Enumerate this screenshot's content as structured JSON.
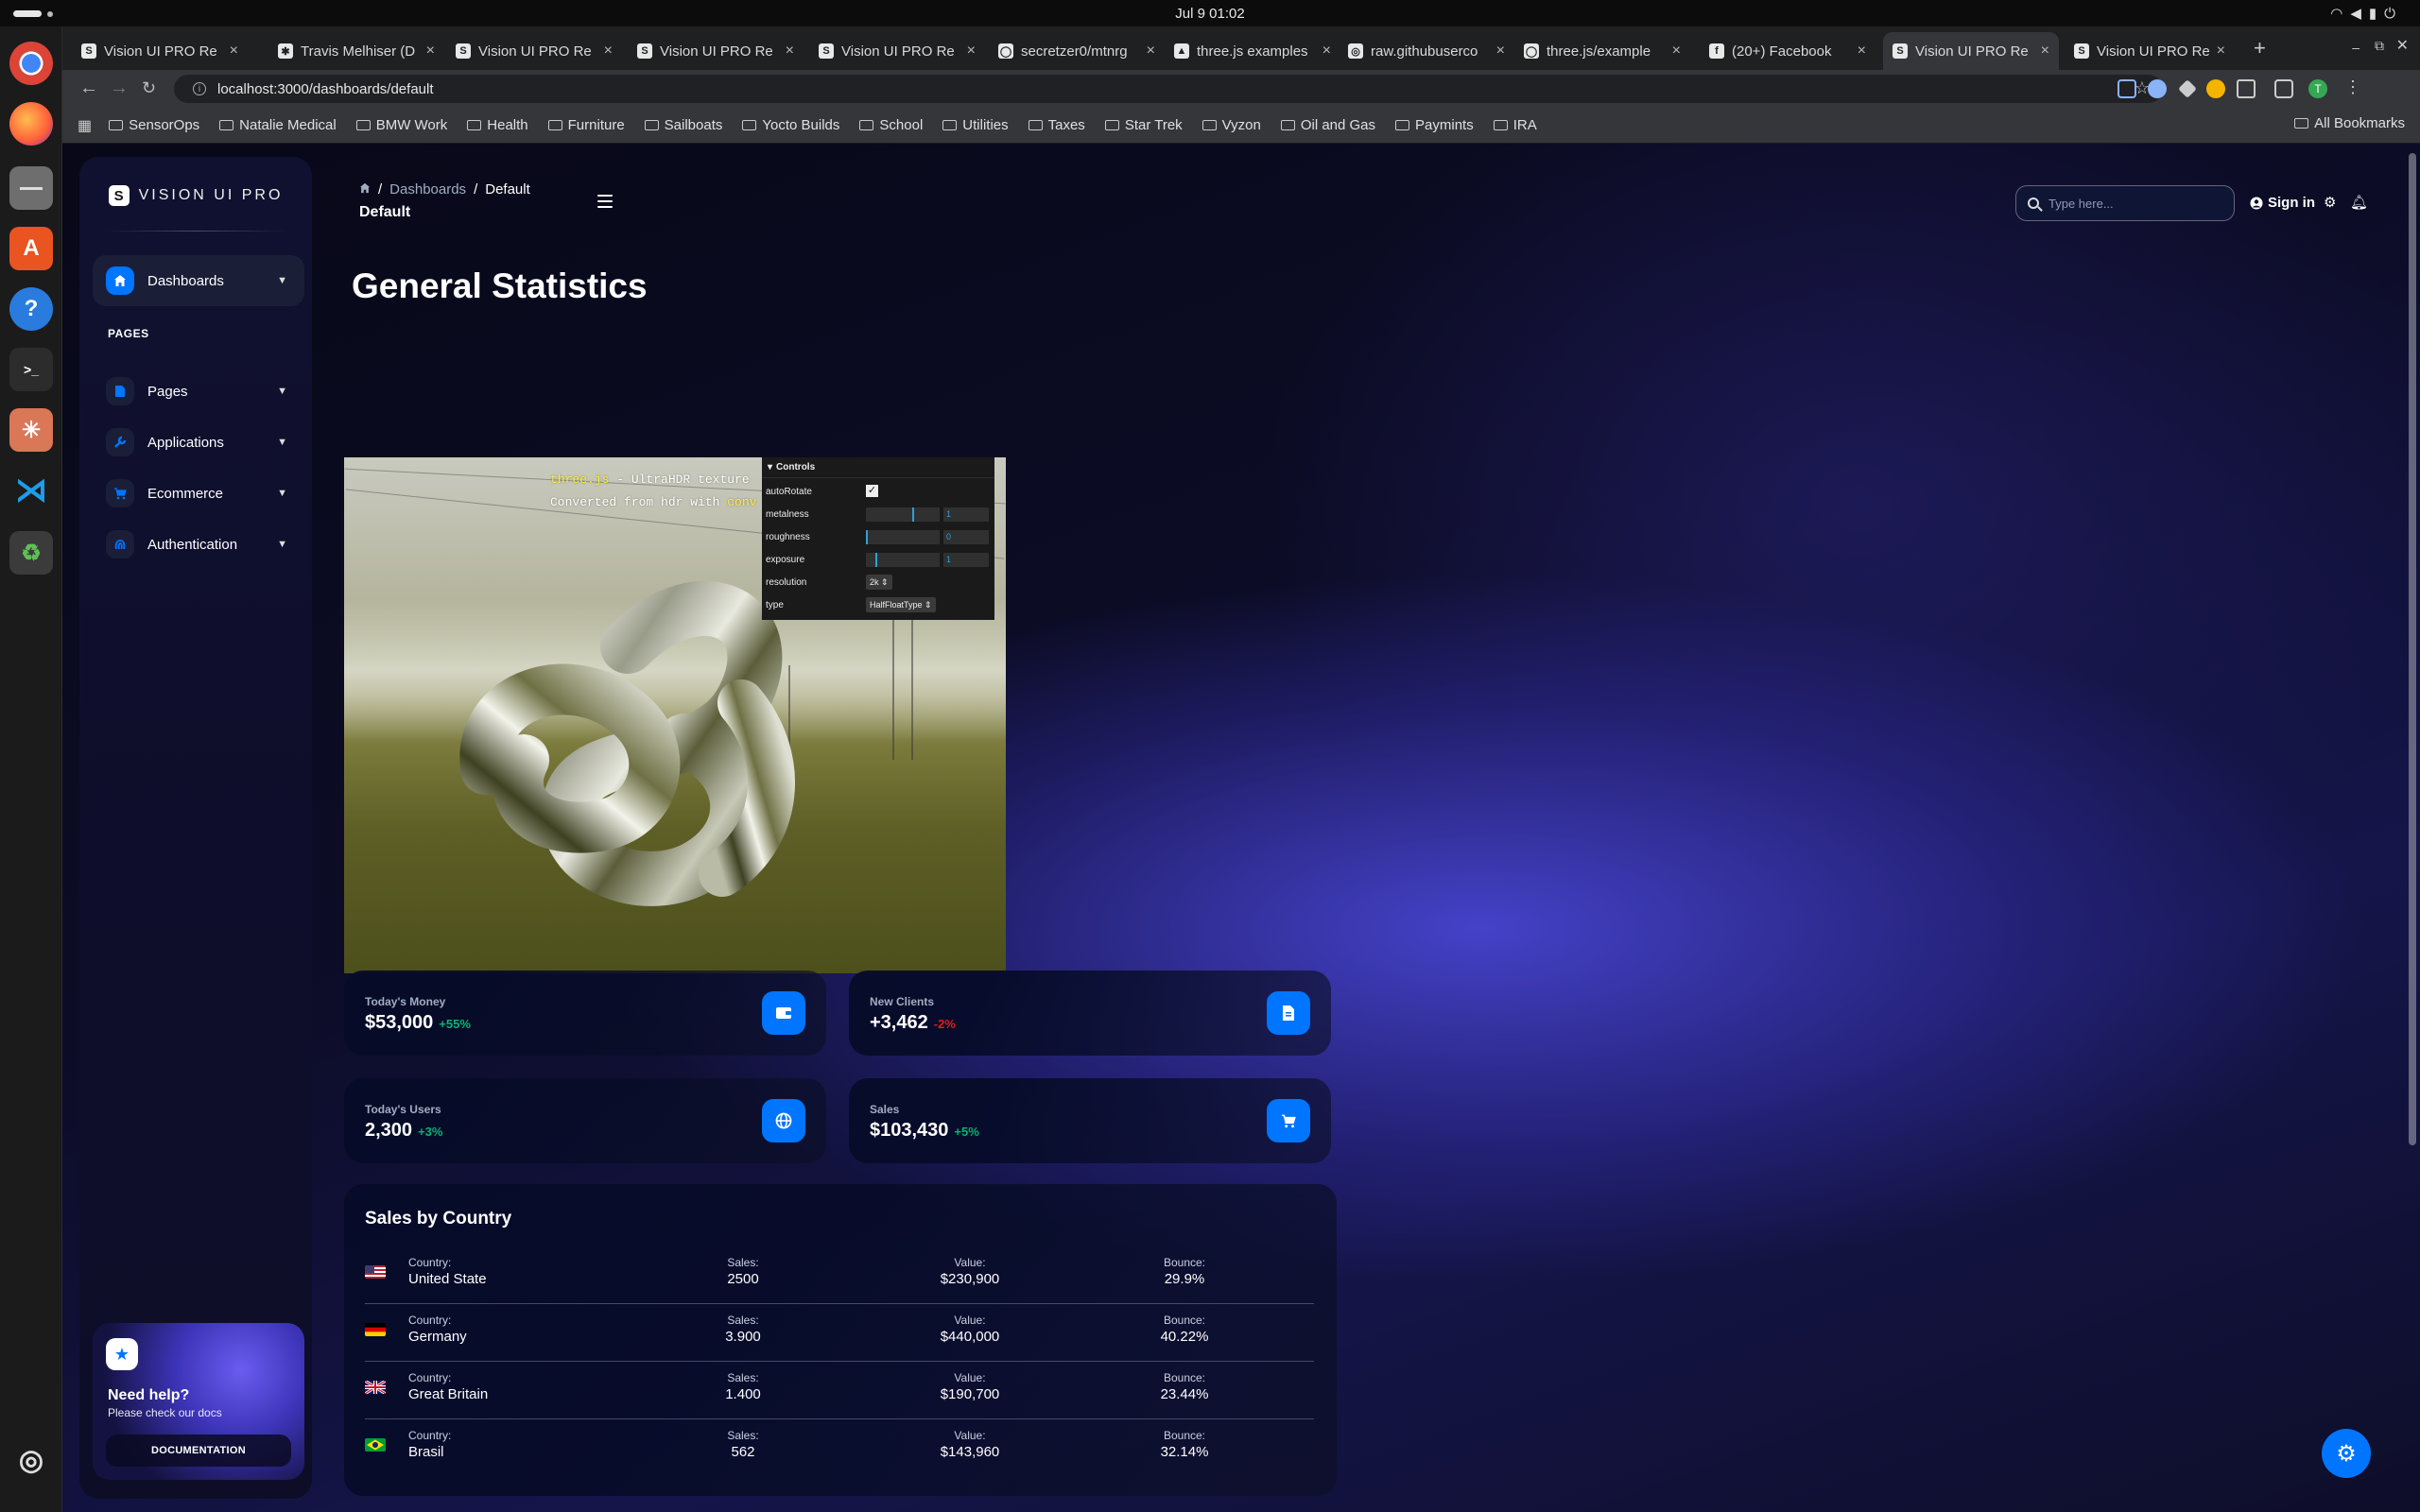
{
  "system": {
    "clock": "Jul 9  01:02"
  },
  "dock": {
    "apps": [
      "chrome",
      "firefox",
      "files",
      "software",
      "help",
      "terminal",
      "anthropic",
      "vscode",
      "trash",
      "ubuntu"
    ]
  },
  "browser": {
    "tabs": [
      {
        "title": "Vision UI PRO Re",
        "active": false
      },
      {
        "title": "Travis Melhiser (D",
        "active": false
      },
      {
        "title": "Vision UI PRO Re",
        "active": false
      },
      {
        "title": "Vision UI PRO Re",
        "active": false
      },
      {
        "title": "Vision UI PRO Re",
        "active": false
      },
      {
        "title": "secretzer0/mtnrg",
        "active": false
      },
      {
        "title": "three.js examples",
        "active": false
      },
      {
        "title": "raw.githubuserco",
        "active": false
      },
      {
        "title": "three.js/example",
        "active": false
      },
      {
        "title": "(20+) Facebook",
        "active": false
      },
      {
        "title": "Vision UI PRO Re",
        "active": true
      },
      {
        "title": "Vision UI PRO Re",
        "active": false
      }
    ],
    "new_tab": "+",
    "url": "localhost:3000/dashboards/default",
    "bookmarks": [
      "SensorOps",
      "Natalie Medical",
      "BMW Work",
      "Health",
      "Furniture",
      "Sailboats",
      "Yocto Builds",
      "School",
      "Utilities",
      "Taxes",
      "Star Trek",
      "Vyzon",
      "Oil and Gas",
      "Paymints",
      "IRA"
    ],
    "all_bookmarks": "All Bookmarks",
    "profile_initial": "T"
  },
  "sidebar": {
    "brand": "VISION UI PRO",
    "brand_logo": "S",
    "active_item": "Dashboards",
    "section": "PAGES",
    "items": [
      "Pages",
      "Applications",
      "Ecommerce",
      "Authentication"
    ],
    "help": {
      "title": "Need help?",
      "subtitle": "Please check our docs",
      "button": "DOCUMENTATION"
    }
  },
  "header": {
    "breadcrumb": [
      "Dashboards",
      "Default"
    ],
    "title": "Default",
    "search_placeholder": "Type here...",
    "signin": "Sign in"
  },
  "page_title": "General Statistics",
  "embed": {
    "caption_link1": "three.js",
    "caption_rest1": " - UltraHDR texture",
    "caption_line2": "Converted from hdr with ",
    "caption_link2": "conv",
    "gui": {
      "title": "Controls",
      "autoRotate_label": "autoRotate",
      "autoRotate": true,
      "metalness_label": "metalness",
      "metalness": "1",
      "metalness_fill": 0.65,
      "roughness_label": "roughness",
      "roughness": "0",
      "roughness_fill": 0.0,
      "exposure_label": "exposure",
      "exposure": "1",
      "exposure_fill": 0.16,
      "resolution_label": "resolution",
      "resolution": "2k",
      "type_label": "type",
      "type": "HalfFloatType"
    }
  },
  "stats": [
    {
      "label": "Today's Money",
      "value": "$53,000",
      "change": "+55%",
      "trend": "up",
      "icon": "wallet-icon"
    },
    {
      "label": "New Clients",
      "value": "+3,462",
      "change": "-2%",
      "trend": "down",
      "icon": "document-icon"
    },
    {
      "label": "Today's Users",
      "value": "2,300",
      "change": "+3%",
      "trend": "up",
      "icon": "globe-icon"
    },
    {
      "label": "Sales",
      "value": "$103,430",
      "change": "+5%",
      "trend": "up",
      "icon": "cart-icon"
    }
  ],
  "sales_by_country": {
    "title": "Sales by Country",
    "headers": {
      "country": "Country:",
      "sales": "Sales:",
      "value": "Value:",
      "bounce": "Bounce:"
    },
    "rows": [
      {
        "flag": "us",
        "country": "United State",
        "sales": "2500",
        "value": "$230,900",
        "bounce": "29.9%"
      },
      {
        "flag": "de",
        "country": "Germany",
        "sales": "3.900",
        "value": "$440,000",
        "bounce": "40.22%"
      },
      {
        "flag": "gb",
        "country": "Great Britain",
        "sales": "1.400",
        "value": "$190,700",
        "bounce": "23.44%"
      },
      {
        "flag": "br",
        "country": "Brasil",
        "sales": "562",
        "value": "$143,960",
        "bounce": "32.14%"
      }
    ]
  },
  "colors": {
    "accent": "#0075ff",
    "positive": "#01b574",
    "negative": "#e31a1a"
  }
}
